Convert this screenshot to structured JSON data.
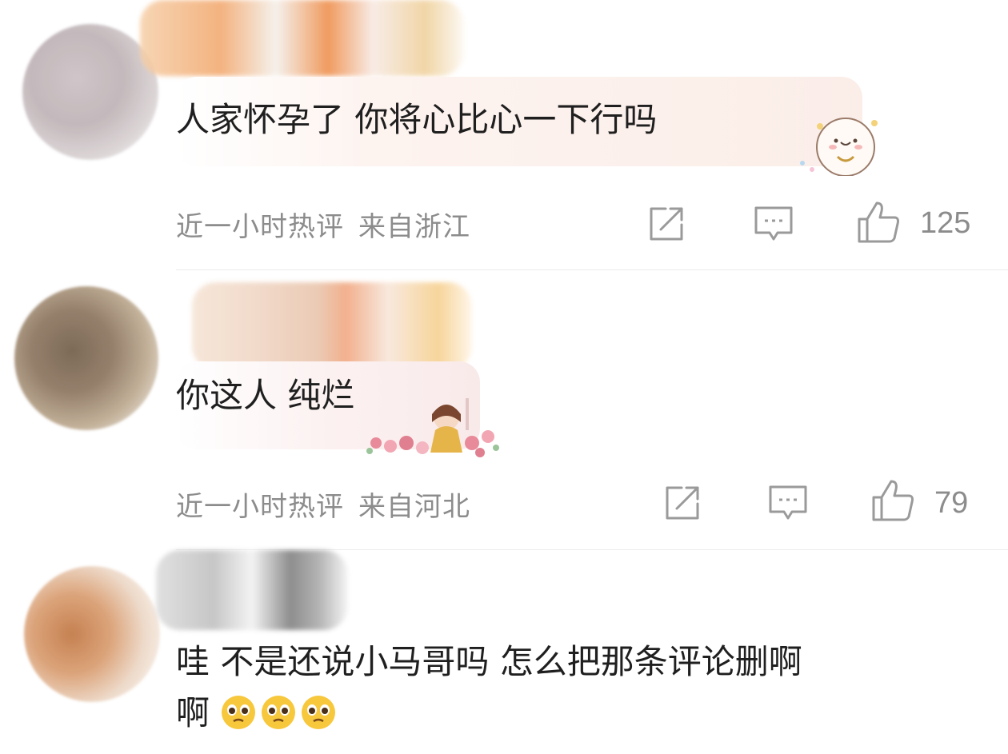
{
  "comments": [
    {
      "text": "人家怀孕了 你将心比心一下行吗",
      "time": "近一小时热评",
      "location": "来自浙江",
      "likes": "125"
    },
    {
      "text": "你这人 纯烂",
      "time": "近一小时热评",
      "location": "来自河北",
      "likes": "79"
    },
    {
      "text_line1": "哇 不是还说小马哥吗 怎么把那条评论删啊",
      "text_line2": "啊"
    }
  ],
  "icons": {
    "share": "share-icon",
    "comment": "comment-icon",
    "like": "thumbs-up-icon",
    "emoji": "pleading-face-emoji"
  },
  "colors": {
    "text": "#1f1f1f",
    "meta": "#8c8c8c",
    "icon": "#9a9a9a",
    "divider": "#ececec",
    "bubble1": "#fdf0ec",
    "bubble2": "#fbeeee"
  }
}
